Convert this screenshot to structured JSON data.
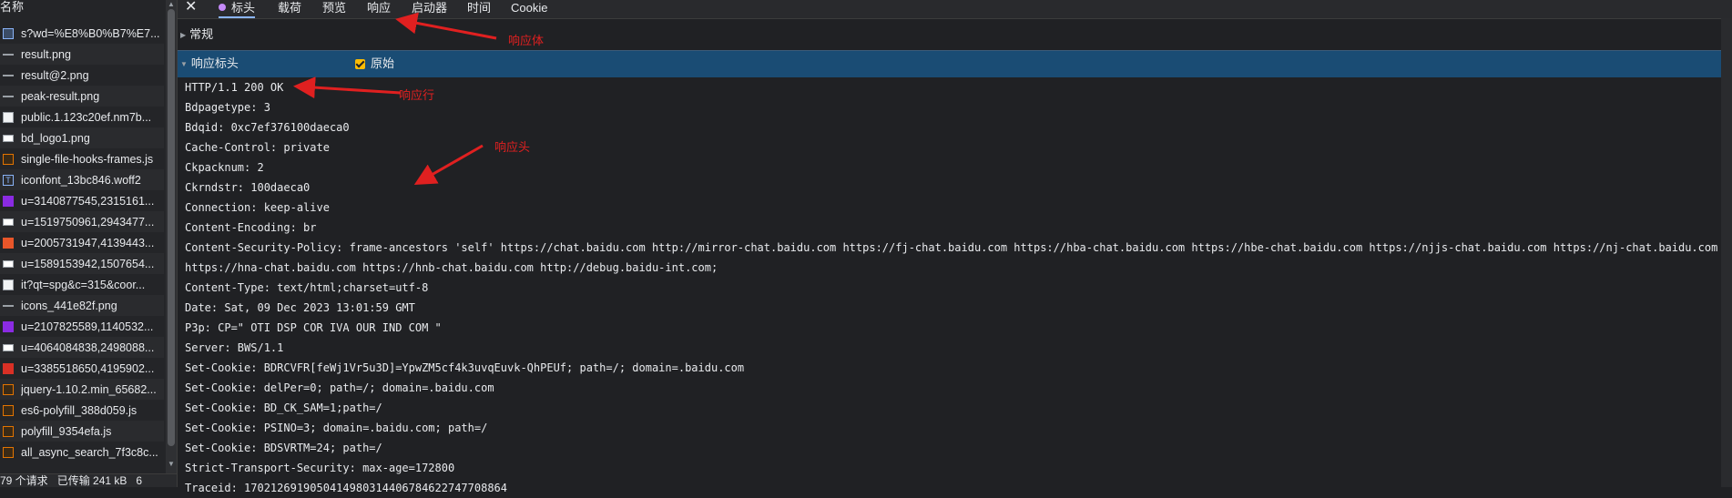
{
  "request_list": {
    "header": "名称",
    "items": [
      {
        "name": "s?wd=%E8%B0%B7%E7...",
        "icon": "document-icon"
      },
      {
        "name": "result.png",
        "icon": "image-icon"
      },
      {
        "name": "result@2.png",
        "icon": "image-icon"
      },
      {
        "name": "peak-result.png",
        "icon": "image-icon"
      },
      {
        "name": "public.1.123c20ef.nm7b...",
        "icon": "file-icon"
      },
      {
        "name": "bd_logo1.png",
        "icon": "image-icon"
      },
      {
        "name": "single-file-hooks-frames.js",
        "icon": "script-icon"
      },
      {
        "name": "iconfont_13bc846.woff2",
        "icon": "font-icon"
      },
      {
        "name": "u=3140877545,2315161...",
        "icon": "image-icon"
      },
      {
        "name": "u=1519750961,2943477...",
        "icon": "image-icon"
      },
      {
        "name": "u=2005731947,4139443...",
        "icon": "image-icon"
      },
      {
        "name": "u=1589153942,1507654...",
        "icon": "image-icon"
      },
      {
        "name": "it?qt=spg&c=315&coor...",
        "icon": "file-icon"
      },
      {
        "name": "icons_441e82f.png",
        "icon": "image-icon"
      },
      {
        "name": "u=2107825589,1140532...",
        "icon": "image-icon"
      },
      {
        "name": "u=4064084838,2498088...",
        "icon": "image-icon"
      },
      {
        "name": "u=3385518650,4195902...",
        "icon": "image-icon"
      },
      {
        "name": "jquery-1.10.2.min_65682...",
        "icon": "script-icon"
      },
      {
        "name": "es6-polyfill_388d059.js",
        "icon": "script-icon"
      },
      {
        "name": "polyfill_9354efa.js",
        "icon": "script-icon"
      },
      {
        "name": "all_async_search_7f3c8c...",
        "icon": "script-icon"
      }
    ],
    "status": {
      "requests": "79 个请求",
      "transferred": "已传输 241 kB",
      "extra": "6"
    }
  },
  "tabs": [
    {
      "label": "标头"
    },
    {
      "label": "载荷"
    },
    {
      "label": "预览"
    },
    {
      "label": "响应"
    },
    {
      "label": "启动器"
    },
    {
      "label": "时间"
    },
    {
      "label": "Cookie"
    }
  ],
  "sections": {
    "general": "常规",
    "response_headers": "响应标头",
    "raw_label": "原始"
  },
  "response_lines": [
    "HTTP/1.1 200 OK",
    "Bdpagetype: 3",
    "Bdqid: 0xc7ef376100daeca0",
    "Cache-Control: private",
    "Ckpacknum: 2",
    "Ckrndstr: 100daeca0",
    "Connection: keep-alive",
    "Content-Encoding: br",
    "Content-Security-Policy: frame-ancestors 'self' https://chat.baidu.com http://mirror-chat.baidu.com https://fj-chat.baidu.com https://hba-chat.baidu.com https://hbe-chat.baidu.com https://njjs-chat.baidu.com https://nj-chat.baidu.com",
    "https://hna-chat.baidu.com https://hnb-chat.baidu.com http://debug.baidu-int.com;",
    "Content-Type: text/html;charset=utf-8",
    "Date: Sat, 09 Dec 2023 13:01:59 GMT",
    "P3p: CP=\" OTI DSP COR IVA OUR IND COM \"",
    "Server: BWS/1.1",
    "Set-Cookie: BDRCVFR[feWj1Vr5u3D]=YpwZM5cf4k3uvqEuvk-QhPEUf; path=/; domain=.baidu.com",
    "Set-Cookie: delPer=0; path=/; domain=.baidu.com",
    "Set-Cookie: BD_CK_SAM=1;path=/",
    "Set-Cookie: PSINO=3; domain=.baidu.com; path=/",
    "Set-Cookie: BDSVRTM=24; path=/",
    "Strict-Transport-Security: max-age=172800",
    "Traceid: 1702126919050414980314406784622747708864"
  ],
  "annotations": {
    "response_body": "响应体",
    "response_line": "响应行",
    "response_header": "响应头",
    "color": "#e02020"
  }
}
